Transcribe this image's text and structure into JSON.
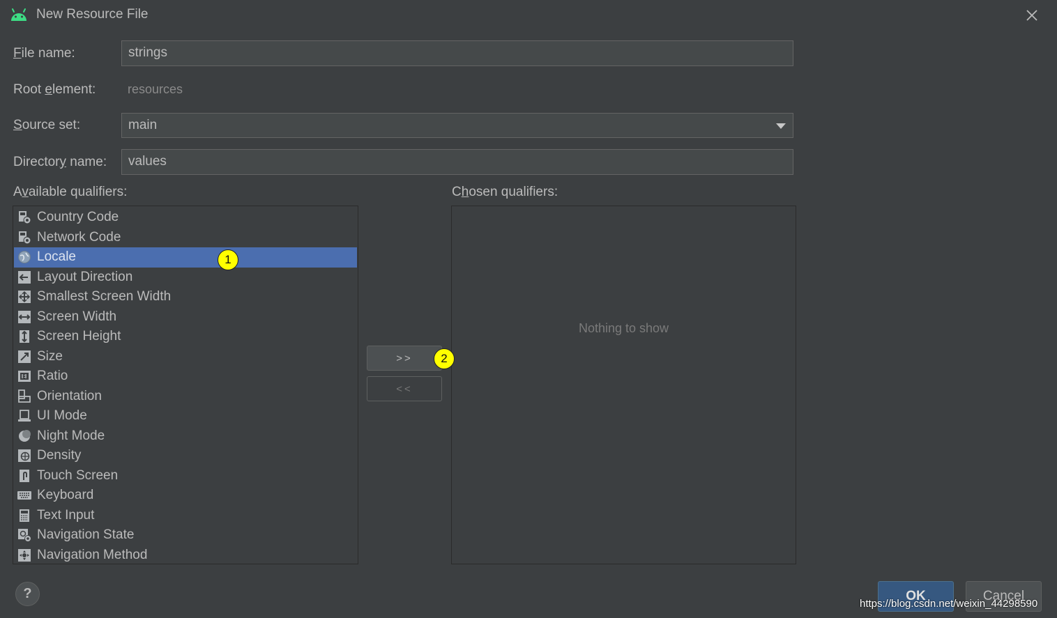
{
  "window": {
    "title": "New Resource File",
    "icon": "android-icon",
    "close_icon": "close-icon"
  },
  "form": {
    "file_name": {
      "label_mnemonic": "F",
      "label_rest": "ile name:",
      "value": "strings"
    },
    "root_element": {
      "label_pre": "Root ",
      "label_mnemonic": "e",
      "label_post": "lement:",
      "value": "resources"
    },
    "source_set": {
      "label_mnemonic": "S",
      "label_rest": "ource set:",
      "value": "main"
    },
    "directory_name": {
      "label_pre": "Director",
      "label_mnemonic": "y",
      "label_post": " name:",
      "value": "values"
    }
  },
  "available": {
    "label_pre": "A",
    "label_mnemonic": "v",
    "label_post": "ailable qualifiers:",
    "items": [
      {
        "label": "Country Code",
        "icon": "country-code-icon"
      },
      {
        "label": "Network Code",
        "icon": "network-code-icon"
      },
      {
        "label": "Locale",
        "icon": "globe-icon",
        "selected": true
      },
      {
        "label": "Layout Direction",
        "icon": "layout-direction-icon"
      },
      {
        "label": "Smallest Screen Width",
        "icon": "smallest-screen-width-icon"
      },
      {
        "label": "Screen Width",
        "icon": "screen-width-icon"
      },
      {
        "label": "Screen Height",
        "icon": "screen-height-icon"
      },
      {
        "label": "Size",
        "icon": "size-icon"
      },
      {
        "label": "Ratio",
        "icon": "ratio-icon"
      },
      {
        "label": "Orientation",
        "icon": "orientation-icon"
      },
      {
        "label": "UI Mode",
        "icon": "ui-mode-icon"
      },
      {
        "label": "Night Mode",
        "icon": "night-mode-icon"
      },
      {
        "label": "Density",
        "icon": "density-icon"
      },
      {
        "label": "Touch Screen",
        "icon": "touch-screen-icon"
      },
      {
        "label": "Keyboard",
        "icon": "keyboard-icon"
      },
      {
        "label": "Text Input",
        "icon": "text-input-icon"
      },
      {
        "label": "Navigation State",
        "icon": "navigation-state-icon"
      },
      {
        "label": "Navigation Method",
        "icon": "navigation-method-icon"
      }
    ]
  },
  "chosen": {
    "label_pre": "C",
    "label_mnemonic": "h",
    "label_post": "osen qualifiers:",
    "empty_text": "Nothing to show"
  },
  "buttons": {
    "add": ">>",
    "remove": "<<",
    "help": "?",
    "ok": "OK",
    "cancel": "Cancel"
  },
  "annotations": {
    "badge1": "1",
    "badge2": "2"
  },
  "watermark": "https://blog.csdn.net/weixin_44298590",
  "colors": {
    "background": "#3c3f41",
    "selection": "#4b6eaf",
    "ok_button": "#365880",
    "badge": "#ffff00"
  }
}
